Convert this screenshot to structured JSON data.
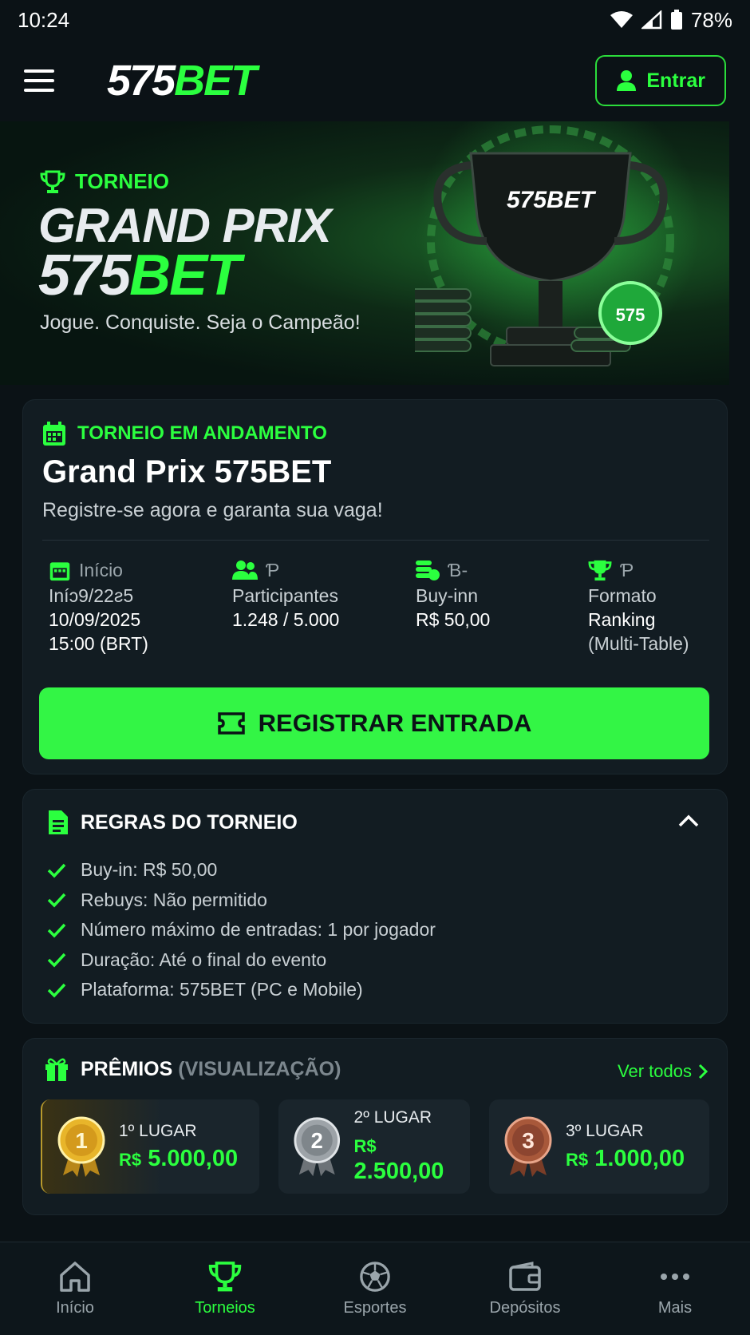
{
  "status_bar": {
    "time": "10:24",
    "battery": "78%"
  },
  "header": {
    "logo_part1": "575",
    "logo_part2": "BET",
    "login_label": "Entrar"
  },
  "banner": {
    "label": "TORNEIO",
    "title_line1": "GRAND PRIX",
    "title_line2a": "575",
    "title_line2b": "BET",
    "subtitle": "Jogue. Conquiste. Seja o Campeão!",
    "trophy_text": "575BET",
    "chip_text": "575"
  },
  "tournament": {
    "status": "TORNEIO EM ANDAMENTO",
    "title": "Grand Prix 575BET",
    "subtitle": "Registre-se agora e garanta sua vaga!",
    "info": [
      {
        "head": "Início",
        "lines": [
          "Iníɔ9/22ƨ5",
          "10/09/2025",
          "15:00 (BRT)"
        ]
      },
      {
        "head": "Ƥ",
        "lines": [
          "Participantes",
          "1.248 / 5.000"
        ]
      },
      {
        "head": "Ɓ-",
        "lines": [
          "Buy-inn",
          "R$ 50,00"
        ]
      },
      {
        "head": "Ƥ",
        "lines": [
          "Formato",
          "Ranking",
          "(Multi-Table)"
        ]
      }
    ],
    "register_label": "REGISTRAR ENTRADA"
  },
  "rules": {
    "title": "REGRAS DO TORNEIO",
    "items": [
      "Buy-in: R$ 50,00",
      "Rebuys: Não permitido",
      "Número máximo de entradas: 1 por jogador",
      "Duração: Até o final do evento",
      "Plataforma: 575BET (PC e Mobile)"
    ]
  },
  "prizes": {
    "title": "PRÊMIOS",
    "title_muted": "(VISUALIZAÇÃO)",
    "view_all": "Ver todos",
    "items": [
      {
        "medal": "1",
        "place": "1º LUGAR",
        "currency": "R$",
        "amount": "5.000,00",
        "color": "#d9a621"
      },
      {
        "medal": "2",
        "place": "2º LUGAR",
        "currency": "R$",
        "amount": "2.500,00",
        "color": "#9da3a8"
      },
      {
        "medal": "3",
        "place": "3º LUGAR",
        "currency": "R$",
        "amount": "1.000,00",
        "color": "#a8583a"
      }
    ]
  },
  "bottom_nav": [
    {
      "label": "Início",
      "icon": "home-icon"
    },
    {
      "label": "Torneios",
      "icon": "trophy-icon",
      "active": true
    },
    {
      "label": "Esportes",
      "icon": "soccer-ball-icon"
    },
    {
      "label": "Depósitos",
      "icon": "wallet-icon"
    },
    {
      "label": "Mais",
      "icon": "more-icon"
    }
  ],
  "colors": {
    "accent": "#2bff3f",
    "background": "#0b1216",
    "card": "#121c22",
    "button": "#33f545"
  }
}
